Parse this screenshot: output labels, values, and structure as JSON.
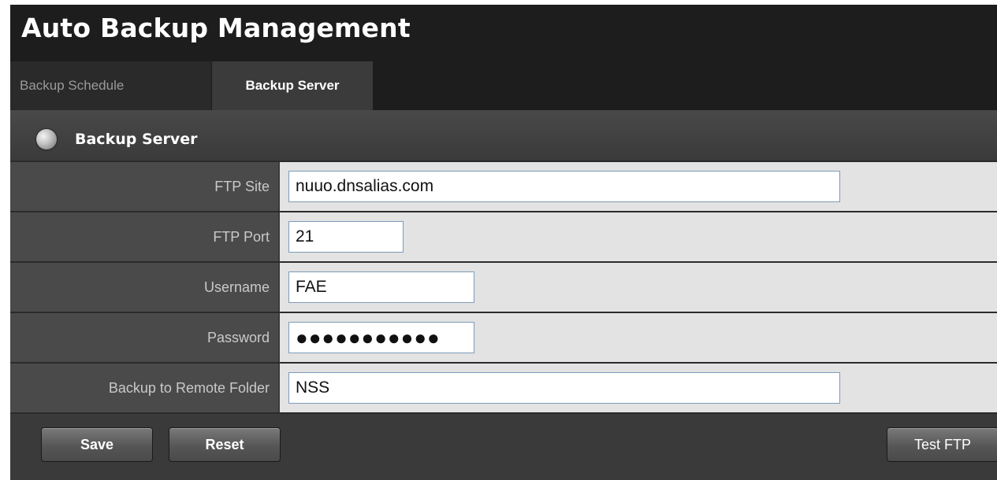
{
  "app": {
    "title": "Auto Backup Management"
  },
  "tabs": [
    {
      "label": "Backup Schedule",
      "active": false
    },
    {
      "label": "Backup Server",
      "active": true
    }
  ],
  "panel": {
    "title": "Backup Server",
    "icon": "globe-icon"
  },
  "form": {
    "ftp_site": {
      "label": "FTP Site",
      "value": "nuuo.dnsalias.com"
    },
    "ftp_port": {
      "label": "FTP Port",
      "value": "21"
    },
    "username": {
      "label": "Username",
      "value": "FAE"
    },
    "password": {
      "label": "Password",
      "value": "●●●●●●●●●●●"
    },
    "remote_folder": {
      "label": "Backup to Remote Folder",
      "value": "NSS"
    }
  },
  "buttons": {
    "save": "Save",
    "reset": "Reset",
    "test_ftp": "Test FTP"
  },
  "colors": {
    "background": "#1d1d1d",
    "panel": "#3a3a3a",
    "label_cell": "#4a4a4a",
    "field_cell": "#e3e3e3",
    "input_border": "#7d9ab8"
  }
}
